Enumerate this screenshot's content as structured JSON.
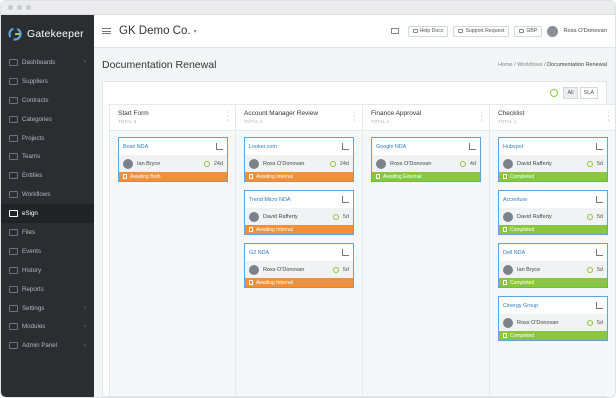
{
  "brand": {
    "name": "Gatekeeper"
  },
  "sidebar": {
    "items": [
      {
        "label": "Dashboards",
        "chevron": true
      },
      {
        "label": "Suppliers",
        "chevron": false
      },
      {
        "label": "Contracts",
        "chevron": false
      },
      {
        "label": "Categories",
        "chevron": false
      },
      {
        "label": "Projects",
        "chevron": false
      },
      {
        "label": "Teams",
        "chevron": false
      },
      {
        "label": "Entities",
        "chevron": false
      },
      {
        "label": "Workflows",
        "chevron": false
      },
      {
        "label": "eSign",
        "chevron": false,
        "active": true
      },
      {
        "label": "Files",
        "chevron": false
      },
      {
        "label": "Events",
        "chevron": false
      },
      {
        "label": "History",
        "chevron": false
      },
      {
        "label": "Reports",
        "chevron": false
      },
      {
        "label": "Settings",
        "chevron": true
      },
      {
        "label": "Modules",
        "chevron": true
      },
      {
        "label": "Admin Panel",
        "chevron": true
      }
    ]
  },
  "topbar": {
    "company": "GK Demo Co.",
    "help_docs": "Help Docs",
    "support": "Support Request",
    "currency": "GBP",
    "user": "Ross O'Donovan"
  },
  "page": {
    "title": "Documentation Renewal",
    "breadcrumb": [
      "Home",
      "Workflows",
      "Documentation Renewal"
    ]
  },
  "filter": {
    "all": "All",
    "sla": "SLA"
  },
  "columns": [
    {
      "title": "Start Form",
      "subtitle": "TOTAL 0",
      "cards": [
        {
          "name": "Bose NDA",
          "person": "Ian Bryce",
          "days": "24d",
          "status": "Awaiting Both",
          "status_color": "#f0913a"
        }
      ]
    },
    {
      "title": "Account Manager Review",
      "subtitle": "TOTAL 1",
      "cards": [
        {
          "name": "Looker.com",
          "person": "Ross O'Donovan",
          "days": "24d",
          "status": "Awaiting Internal",
          "status_color": "#f0913a"
        },
        {
          "name": "Trend Micro NDA",
          "person": "David Rafferty",
          "days": "5d",
          "status": "Awaiting Internal",
          "status_color": "#f0913a"
        },
        {
          "name": "G2 NDA",
          "person": "Ross O'Donovan",
          "days": "5d",
          "status": "Awaiting Internal",
          "status_color": "#f0913a"
        }
      ]
    },
    {
      "title": "Finance Approval",
      "subtitle": "TOTAL 1",
      "cards": [
        {
          "name": "Google NDA",
          "person": "Ross O'Donovan",
          "days": "4d",
          "status": "Awaiting External",
          "status_color": "#8cc63f"
        }
      ]
    },
    {
      "title": "Checklist",
      "subtitle": "TOTAL 1",
      "cards": [
        {
          "name": "Hubspot",
          "person": "David Rafferty",
          "days": "5d",
          "status": "Completed",
          "status_color": "#8cc63f"
        },
        {
          "name": "Accenture",
          "person": "David Rafferty",
          "days": "5d",
          "status": "Completed",
          "status_color": "#8cc63f"
        },
        {
          "name": "Dell NDA",
          "person": "Ian Bryce",
          "days": "5d",
          "status": "Completed",
          "status_color": "#8cc63f"
        },
        {
          "name": "Cinergy Group",
          "person": "Ross O'Donovan",
          "days": "5d",
          "status": "Completed",
          "status_color": "#8cc63f"
        }
      ]
    }
  ]
}
